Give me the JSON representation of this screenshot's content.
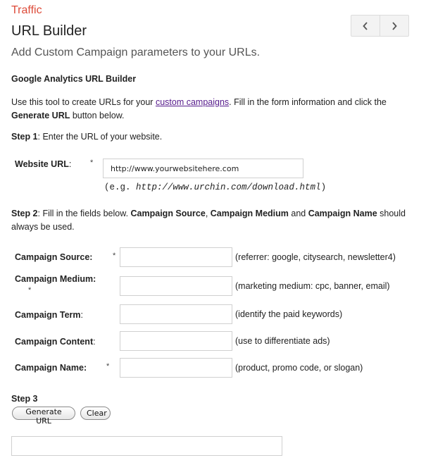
{
  "breadcrumb": "Traffic",
  "page_title": "URL Builder",
  "nav": {
    "prev_icon": "chevron-left-icon",
    "next_icon": "chevron-right-icon"
  },
  "subtitle": "Add Custom Campaign parameters to your URLs.",
  "section_title": "Google Analytics URL Builder",
  "intro": {
    "text_before_link": "Use this tool to create URLs for your ",
    "link_text": "custom campaigns",
    "text_after_link": ". Fill in the form information and click the ",
    "bold_button": "Generate URL",
    "text_end": " button below."
  },
  "step1": {
    "label": "Step 1",
    "text": ": Enter the URL of your website."
  },
  "website_url": {
    "label": "Website URL",
    "colon": ":",
    "required_mark": "*",
    "value": "http://www.yourwebsitehere.com",
    "example_prefix": "(e.g. ",
    "example_url": "http://www.urchin.com/download.html",
    "example_suffix": ")"
  },
  "step2": {
    "label": "Step 2",
    "text1": ": Fill in the fields below. ",
    "bold1": "Campaign Source",
    "text2": ", ",
    "bold2": "Campaign Medium",
    "text3": " and ",
    "bold3": "Campaign Name",
    "text4": " should always be used."
  },
  "fields": [
    {
      "label": "Campaign Source",
      "colon": ":",
      "required": "*",
      "value": "",
      "hint": "(referrer: google, citysearch, newsletter4)"
    },
    {
      "label": "Campaign Medium",
      "colon": ":",
      "required": "*",
      "value": "",
      "hint": "(marketing medium: cpc, banner, email)"
    },
    {
      "label": "Campaign Term",
      "colon": ":",
      "required": "",
      "value": "",
      "hint": "(identify the paid keywords)"
    },
    {
      "label": "Campaign Content",
      "colon": ":",
      "required": "",
      "value": "",
      "hint": "(use to differentiate ads)"
    },
    {
      "label": "Campaign Name",
      "colon": ":",
      "required": "*",
      "value": "",
      "hint": "(product, promo code, or slogan)"
    }
  ],
  "step3": {
    "label": "Step 3"
  },
  "buttons": {
    "generate": "Generate URL",
    "clear": "Clear"
  },
  "output": {
    "value": ""
  },
  "colors": {
    "breadcrumb": "#dd4b39",
    "link": "#551a8b",
    "subtitle": "#555555"
  }
}
